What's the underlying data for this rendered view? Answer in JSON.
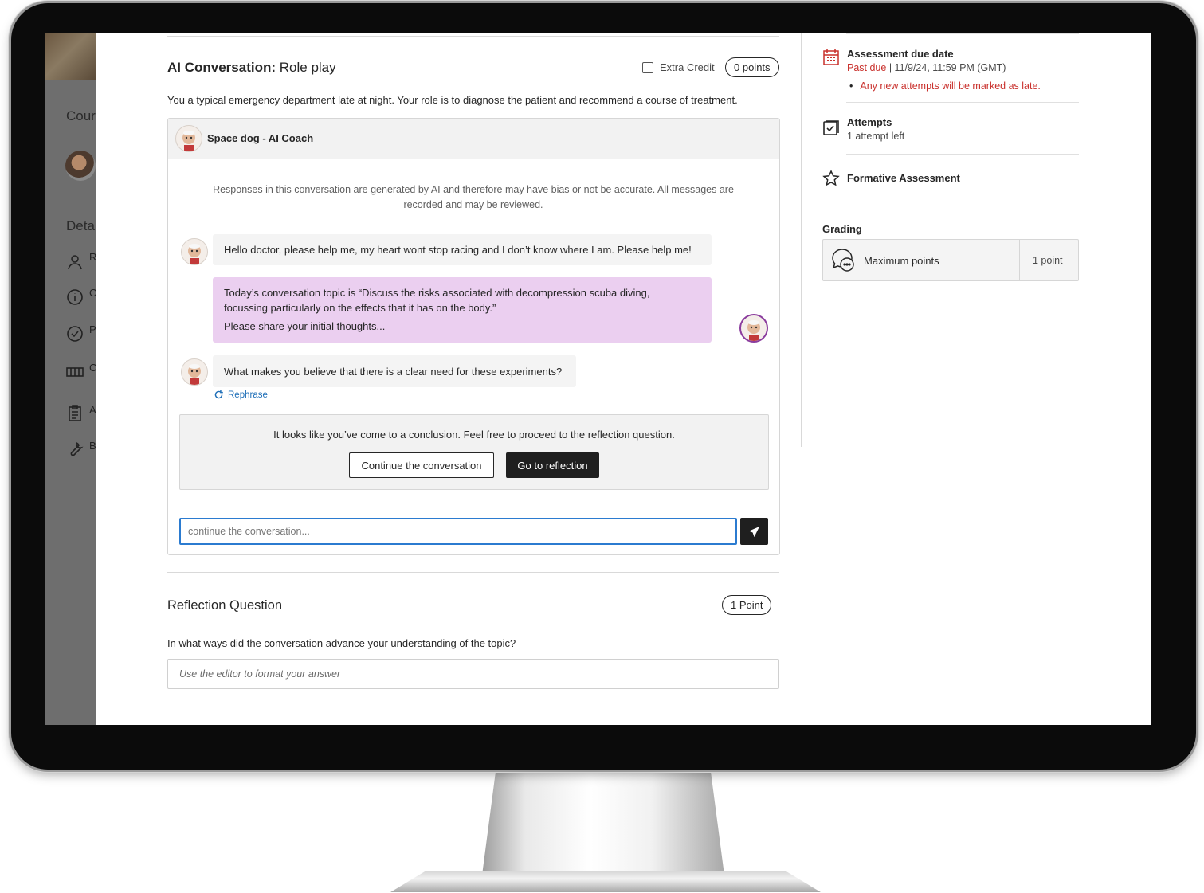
{
  "background_app": {
    "course_label": "Cour",
    "details_label": "Deta",
    "rows": [
      "R",
      "C",
      "P",
      "C",
      "A",
      "B"
    ]
  },
  "assignment": {
    "title_bold": "AI Conversation:",
    "title_rest": " Role play",
    "extra_credit_label": "Extra Credit",
    "points_label": "0 points",
    "intro": "You a typical emergency department late at night. Your role is to diagnose the patient and recommend a course of treatment."
  },
  "chat": {
    "coach_name": "Space dog - AI Coach",
    "disclaimer": "Responses in this conversation are generated by AI and therefore may have bias or not be accurate. All messages are recorded and may be reviewed.",
    "messages": [
      {
        "role": "ai",
        "text": "Hello doctor, please help me, my heart wont stop racing and I don’t know where I am. Please help me!"
      },
      {
        "role": "user",
        "lines": [
          "Today’s conversation topic is “Discuss the risks associated with decompression scuba diving,",
          "focussing particularly on the effects that it has on the body.”",
          "Please share your initial thoughts..."
        ]
      },
      {
        "role": "ai",
        "text": "What makes you believe that there is a clear need for these experiments?"
      }
    ],
    "rephrase_label": "Rephrase",
    "conclusion_text": "It looks like you’ve come to a conclusion. Feel free to proceed to the reflection question.",
    "continue_button": "Continue the conversation",
    "reflection_button": "Go to reflection",
    "input_placeholder": "continue the conversation..."
  },
  "reflection": {
    "title": "Reflection Question",
    "points_label": "1 Point",
    "question": "In what ways did the conversation advance your understanding of the topic?",
    "editor_placeholder": "Use the editor to format your answer"
  },
  "sidebar": {
    "due_date": {
      "label": "Assessment due date",
      "status": "Past due",
      "separator": " | ",
      "date": "11/9/24, 11:59 PM (GMT)",
      "late_note": "Any new attempts will be marked as late."
    },
    "attempts": {
      "label": "Attempts",
      "value": "1 attempt left"
    },
    "assessment_type": "Formative Assessment",
    "grading": {
      "label": "Grading",
      "row_label": "Maximum points",
      "row_value": "1 point"
    }
  },
  "colors": {
    "accent_blue": "#2b7bd0",
    "user_bubble": "#ebcff0",
    "late_red": "#c9302c",
    "dark_button": "#1f1f1f"
  }
}
